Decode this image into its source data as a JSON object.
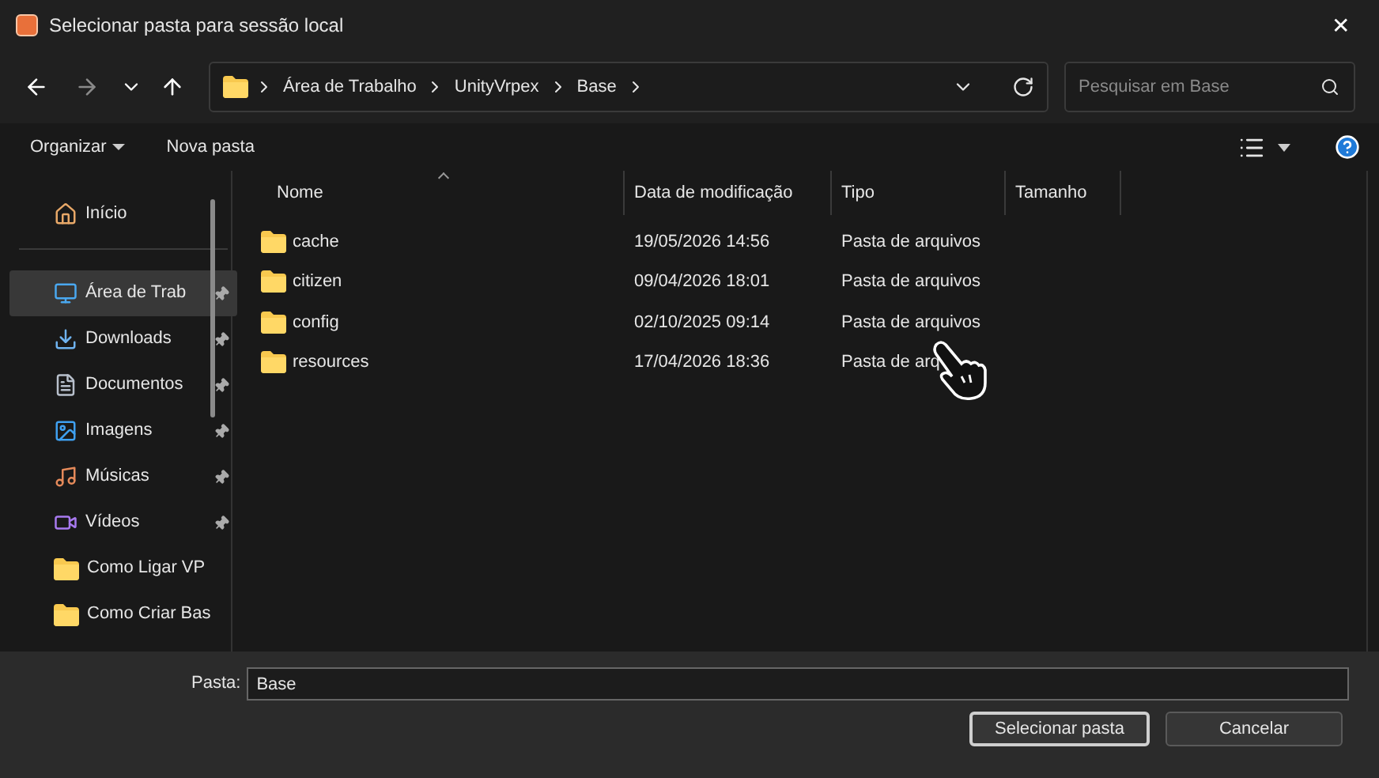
{
  "window": {
    "title": "Selecionar pasta para sessão local",
    "close": "✕"
  },
  "breadcrumb": [
    "Área de Trabalho",
    "UnityVrpex",
    "Base"
  ],
  "search": {
    "placeholder": "Pesquisar em Base"
  },
  "toolbar": {
    "organize": "Organizar",
    "new_folder": "Nova pasta"
  },
  "sidebar": {
    "items": [
      {
        "label": "Início",
        "kind": "home",
        "pinned": false,
        "selected": false
      },
      {
        "label": "Área de Trab",
        "kind": "desktop",
        "pinned": true,
        "selected": true
      },
      {
        "label": "Downloads",
        "kind": "download",
        "pinned": true,
        "selected": false
      },
      {
        "label": "Documentos",
        "kind": "document",
        "pinned": true,
        "selected": false
      },
      {
        "label": "Imagens",
        "kind": "image",
        "pinned": true,
        "selected": false
      },
      {
        "label": "Músicas",
        "kind": "music",
        "pinned": true,
        "selected": false
      },
      {
        "label": "Vídeos",
        "kind": "video",
        "pinned": true,
        "selected": false
      },
      {
        "label": "Como Ligar VP",
        "kind": "folder",
        "pinned": false,
        "selected": false
      },
      {
        "label": "Como Criar Bas",
        "kind": "folder",
        "pinned": false,
        "selected": false
      }
    ]
  },
  "table": {
    "columns": [
      "Nome",
      "Data de modificação",
      "Tipo",
      "Tamanho"
    ],
    "rows": [
      {
        "name": "cache",
        "modified": "19/05/2026 14:56",
        "type": "Pasta de arquivos"
      },
      {
        "name": "citizen",
        "modified": "09/04/2026 18:01",
        "type": "Pasta de arquivos"
      },
      {
        "name": "config",
        "modified": "02/10/2025 09:14",
        "type": "Pasta de arquivos"
      },
      {
        "name": "resources",
        "modified": "17/04/2026 18:36",
        "type": "Pasta de arq"
      }
    ]
  },
  "footer": {
    "folder_label": "Pasta:",
    "folder_value": "Base",
    "buttons": [
      "Selecionar pasta",
      "Cancelar"
    ]
  }
}
